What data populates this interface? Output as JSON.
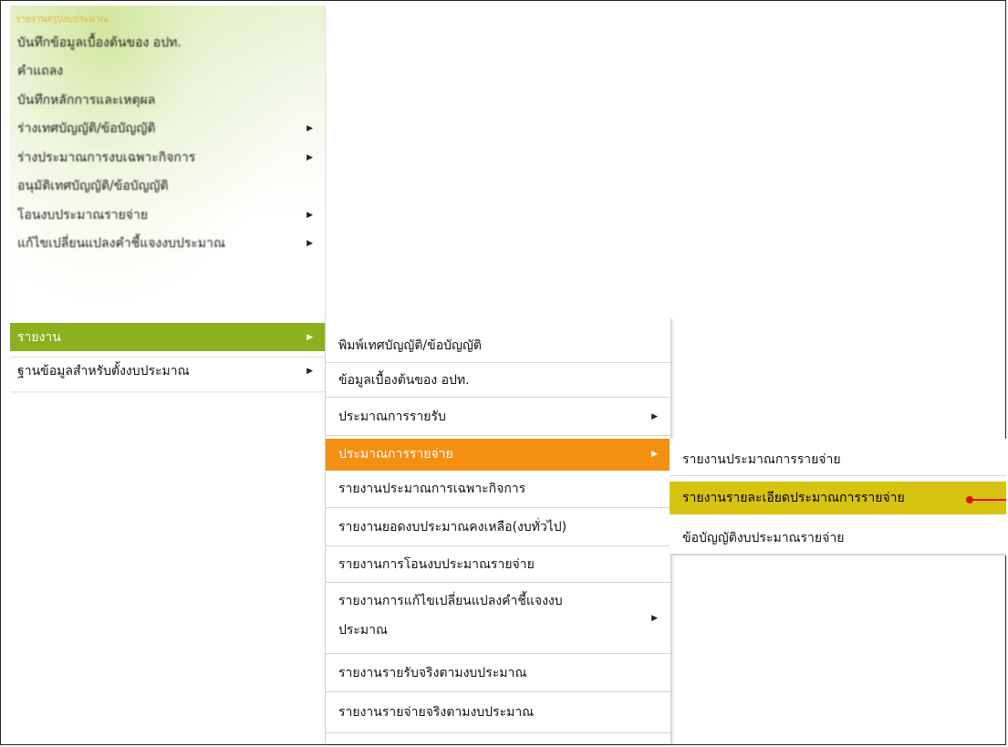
{
  "menu_main": {
    "header": "รายงานสรุปงบประมาณ",
    "items": [
      {
        "label": "บันทึกข้อมูลเบื้องต้นของ อปท.",
        "has_submenu": false
      },
      {
        "label": "คำแถลง",
        "has_submenu": false
      },
      {
        "label": "บันทึกหลักการและเหตุผล",
        "has_submenu": false
      },
      {
        "label": "ร่างเทศบัญญัติ/ข้อบัญญัติ",
        "has_submenu": true
      },
      {
        "label": "ร่างประมาณการงบเฉพาะกิจการ",
        "has_submenu": true
      },
      {
        "label": "อนุมัติเทศบัญญัติ/ข้อบัญญัติ",
        "has_submenu": false
      },
      {
        "label": "โอนงบประมาณรายจ่าย",
        "has_submenu": true
      },
      {
        "label": "แก้ไขเปลี่ยนแปลงคำชี้แจงงบประมาณ",
        "has_submenu": true
      },
      {
        "label": "รายงาน",
        "has_submenu": true
      },
      {
        "label": "ฐานข้อมูลสำหรับตั้งงบประมาณ",
        "has_submenu": true
      }
    ],
    "arrow": "▶"
  },
  "menu_report": {
    "items": [
      {
        "label": "พิมพ์เทศบัญญัติ/ข้อบัญญัติ",
        "has_submenu": false
      },
      {
        "label": "ข้อมูลเบื้องต้นของ อปท.",
        "has_submenu": false
      },
      {
        "label": "ประมาณการรายรับ",
        "has_submenu": true
      },
      {
        "label": "ประมาณการรายจ่าย",
        "has_submenu": true
      },
      {
        "label": "รายงานประมาณการเฉพาะกิจการ",
        "has_submenu": false
      },
      {
        "label": "รายงานยอดงบประมาณคงเหลือ(งบทั่วไป)",
        "has_submenu": false
      },
      {
        "label": "รายงานการโอนงบประมาณรายจ่าย",
        "has_submenu": false
      },
      {
        "label": "รายงานการแก้ไขเปลี่ยนแปลงคำชี้แจงงบ",
        "label_line2": "ประมาณ",
        "has_submenu": true
      },
      {
        "label": "รายงานรายรับจริงตามงบประมาณ",
        "has_submenu": false
      },
      {
        "label": "รายงานรายจ่ายจริงตามงบประมาณ",
        "has_submenu": false
      }
    ]
  },
  "menu_expense": {
    "items": [
      {
        "label": "รายงานประมาณการรายจ่าย"
      },
      {
        "label": "รายงานรายละเอียดประมาณการรายจ่าย"
      },
      {
        "label": "ข้อบัญญัติงบประมาณรายจ่าย"
      }
    ]
  },
  "colors": {
    "active_green": "#8cb01e",
    "highlight_orange": "#f39012",
    "selected_yellow": "#d7c312",
    "pointer_red": "#e01010"
  }
}
